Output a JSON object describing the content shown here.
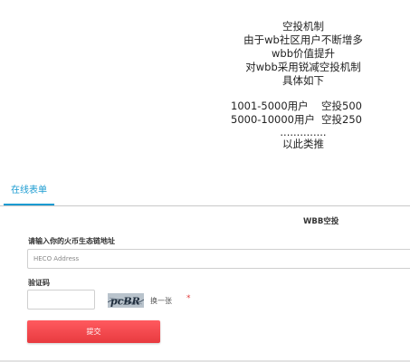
{
  "announcement": {
    "title": "空投机制",
    "line1": "由于wb社区用户不断增多",
    "line2": "wbb价值提升",
    "line3": "对wbb采用锐减空投机制",
    "line4": "具体如下",
    "tiers": [
      {
        "range": "1001-5000用户",
        "reward": "空投500"
      },
      {
        "range": "5000-10000用户",
        "reward": "空投250"
      }
    ],
    "dots": "..............",
    "footer": "以此类推"
  },
  "tabs": [
    {
      "label": "在线表单",
      "active": true
    }
  ],
  "form": {
    "title": "WBB空投",
    "address_label": "请输入你的火币生态链地址",
    "address_placeholder": "HECO Address",
    "address_value": "",
    "code_label": "验证码",
    "code_value": "",
    "captcha_text": "pcBR",
    "refresh_label": "换一张",
    "required_mark": "*",
    "submit_label": "提交"
  },
  "colors": {
    "accent": "#1a9bd1",
    "submit": "#ff4a50",
    "required": "#e23b3b"
  }
}
